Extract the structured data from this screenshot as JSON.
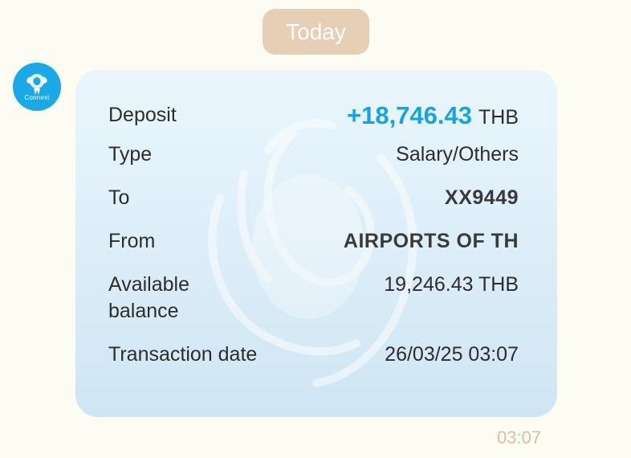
{
  "date_divider": "Today",
  "sender": {
    "avatar_label": "Connext",
    "avatar_color": "#1aa8e6"
  },
  "message": {
    "deposit_label": "Deposit",
    "deposit_amount": "+18,746.43",
    "deposit_currency": "THB",
    "type_label": "Type",
    "type_value": "Salary/Others",
    "to_label": "To",
    "to_value": "XX9449",
    "from_label": "From",
    "from_value": "AIRPORTS OF TH",
    "available_label_line1": "Available",
    "available_label_line2": "balance",
    "available_value": "19,246.43 THB",
    "date_label": "Transaction date",
    "date_value": "26/03/25 03:07"
  },
  "timestamp": "03:07",
  "colors": {
    "amount": "#12a5e2",
    "pill": "#e6cfb4",
    "timestamp": "#d8bfa6"
  }
}
